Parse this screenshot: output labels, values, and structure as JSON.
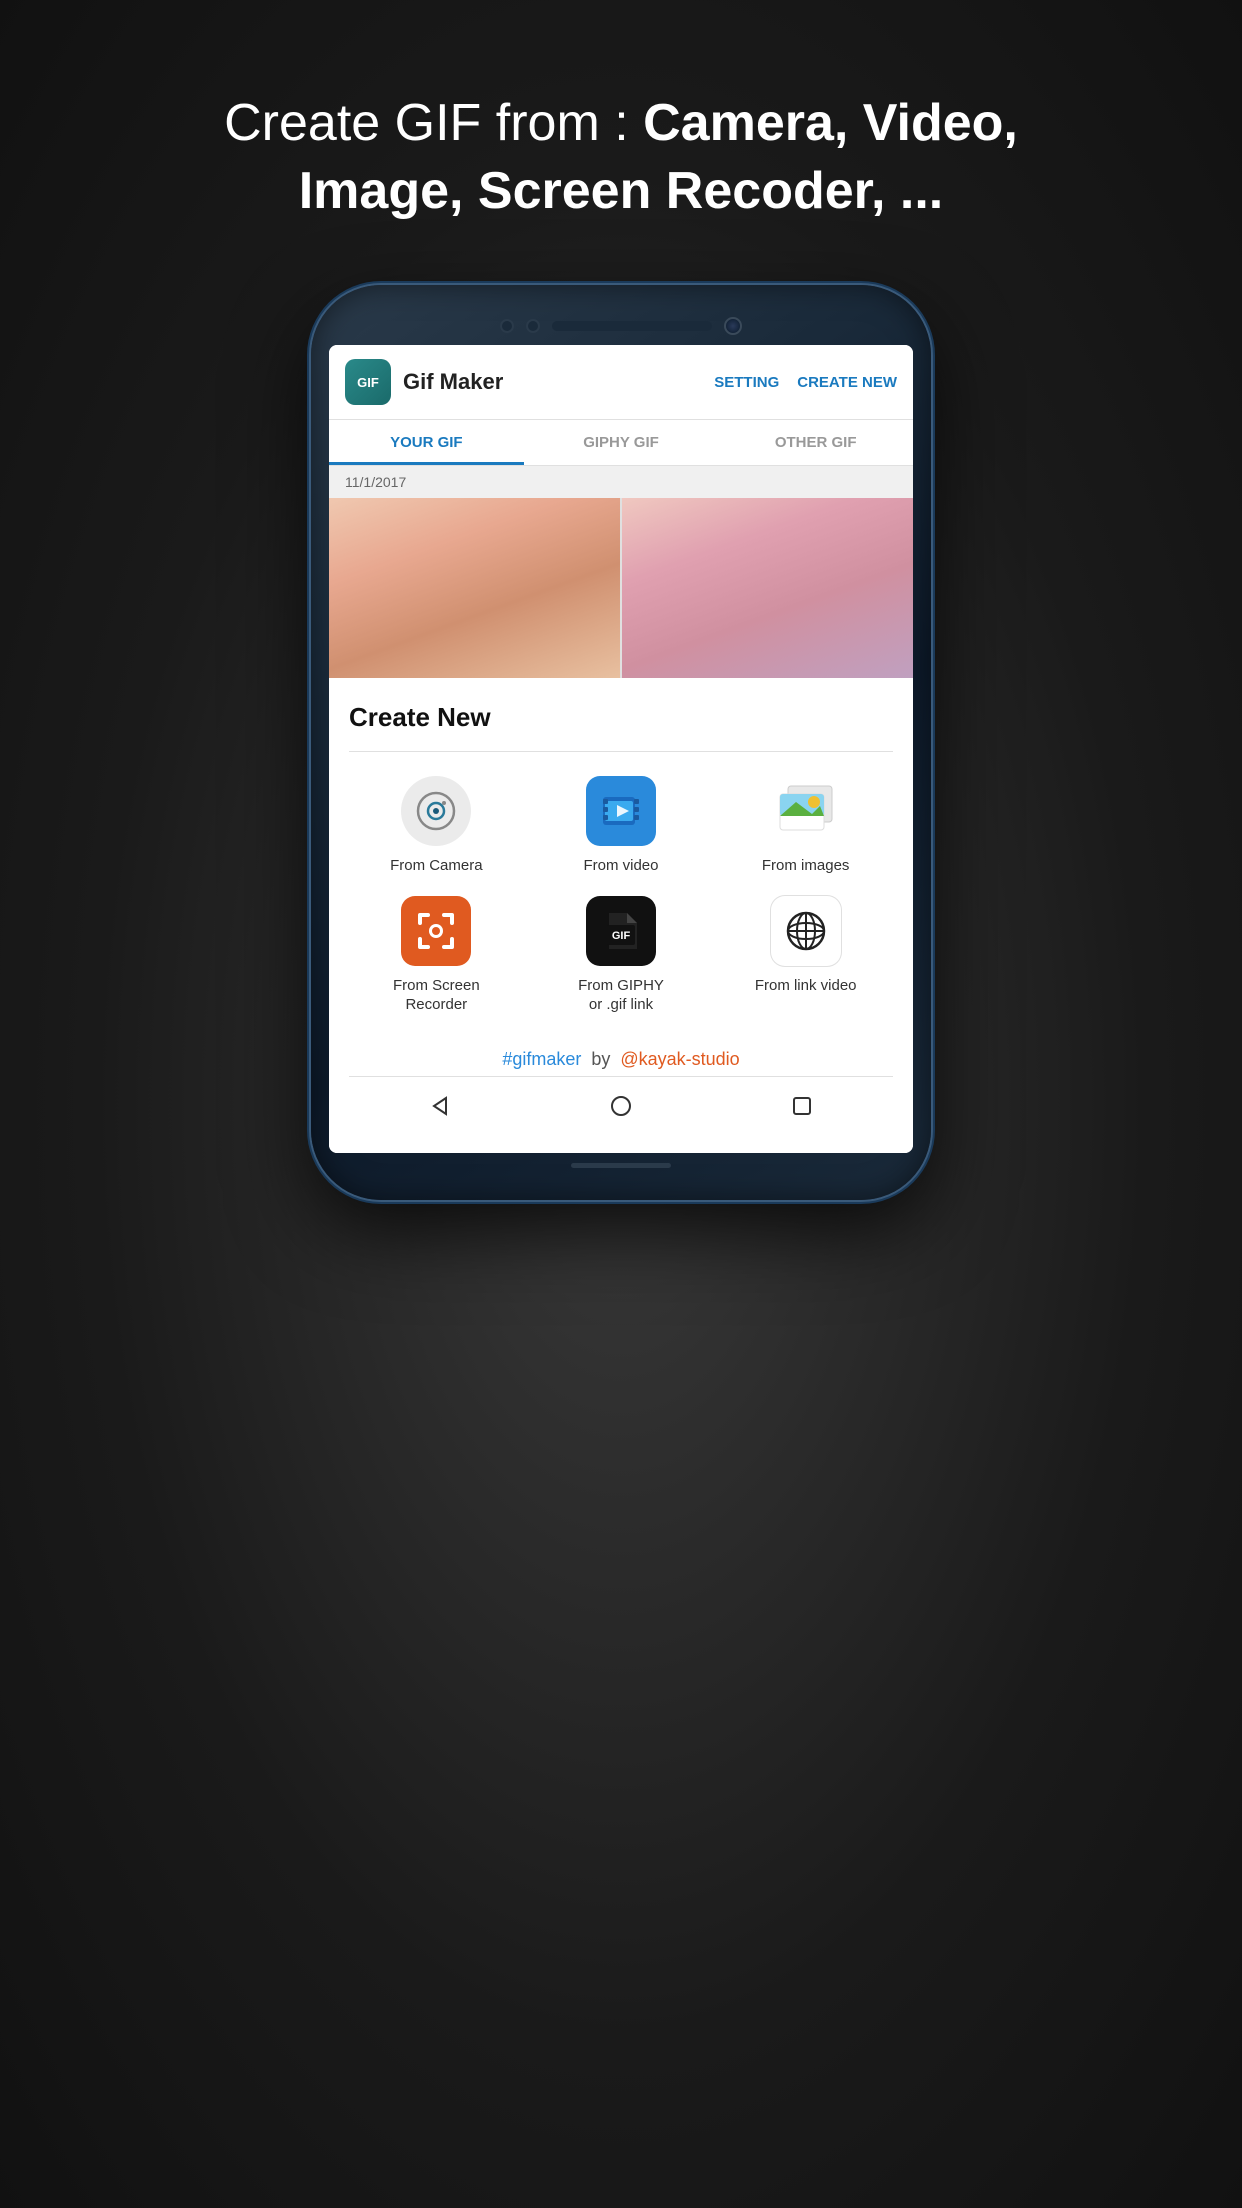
{
  "header": {
    "line1_normal": "Create GIF from : ",
    "line1_bold": "Camera, Video,",
    "line2_bold": "Image, Screen Recoder, ..."
  },
  "app": {
    "logo_text": "GIF",
    "title": "Gif Maker",
    "btn_setting": "SETTING",
    "btn_create": "CREATE NEW"
  },
  "tabs": [
    {
      "label": "YOUR GIF",
      "active": true
    },
    {
      "label": "GIPHY GIF",
      "active": false
    },
    {
      "label": "OTHER GIF",
      "active": false
    }
  ],
  "date_label": "11/1/2017",
  "sheet": {
    "title": "Create New"
  },
  "options": [
    {
      "label": "From Camera",
      "icon_type": "camera"
    },
    {
      "label": "From video",
      "icon_type": "video"
    },
    {
      "label": "From images",
      "icon_type": "images"
    },
    {
      "label": "From Screen\nRecorder",
      "icon_type": "screen"
    },
    {
      "label": "From GIPHY\nor .gif link",
      "icon_type": "giphy"
    },
    {
      "label": "From link video",
      "icon_type": "globe"
    }
  ],
  "footer": {
    "tag": "#gifmaker",
    "by": "by",
    "studio": "@kayak-studio"
  },
  "nav": {
    "back": "◁",
    "home": "○",
    "recent": "□"
  }
}
